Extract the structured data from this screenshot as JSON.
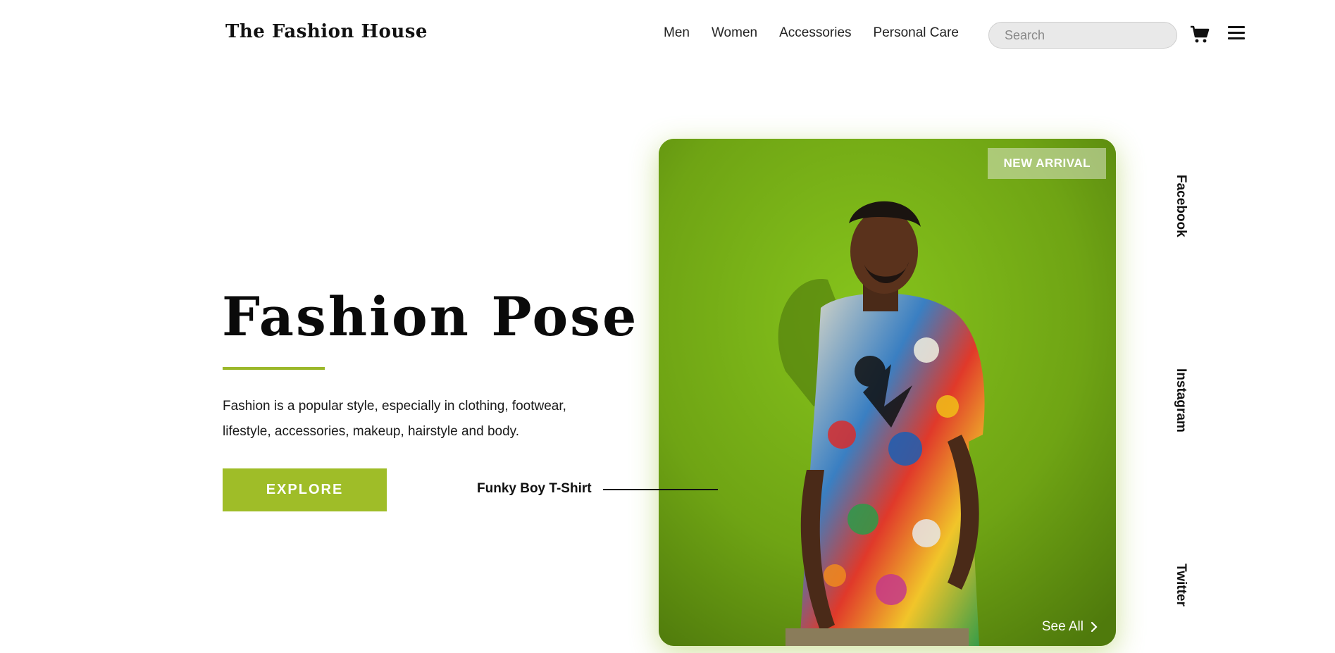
{
  "header": {
    "logo": "The Fashion House",
    "nav": [
      "Men",
      "Women",
      "Accessories",
      "Personal Care"
    ],
    "search_placeholder": "Search"
  },
  "hero": {
    "title": "Fashion Pose",
    "description_line1": "Fashion is a popular style, especially in clothing, footwear,",
    "description_line2": "lifestyle, accessories, makeup, hairstyle and body.",
    "cta_label": "EXPLORE",
    "product_label": "Funky Boy T-Shirt"
  },
  "card": {
    "badge": "NEW ARRIVAL",
    "see_all": "See All"
  },
  "socials": [
    "Facebook",
    "Instagram",
    "Twitter"
  ],
  "colors": {
    "accent": "#9fbd28",
    "text": "#111111"
  },
  "icons": [
    "search-icon",
    "cart-icon",
    "menu-icon",
    "chevron-right-icon"
  ]
}
